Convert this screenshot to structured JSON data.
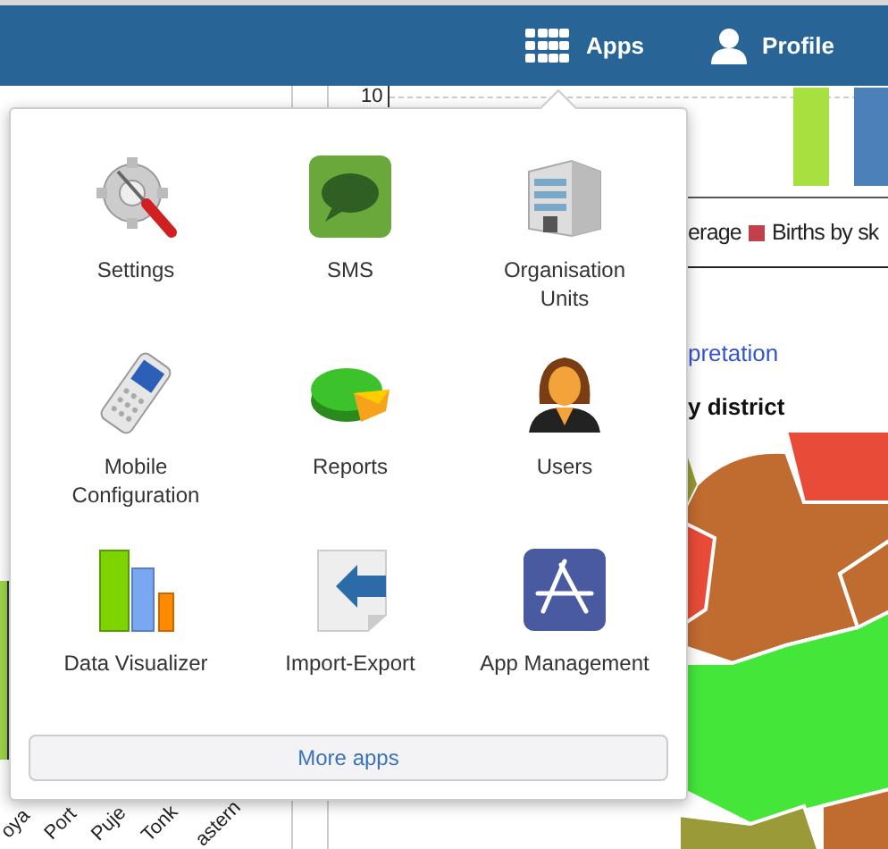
{
  "header": {
    "apps_label": "Apps",
    "profile_label": "Profile"
  },
  "apps_menu": {
    "items": [
      {
        "label": "Settings"
      },
      {
        "label": "SMS"
      },
      {
        "label": "Organisation Units"
      },
      {
        "label": "Mobile Configuration"
      },
      {
        "label": "Reports"
      },
      {
        "label": "Users"
      },
      {
        "label": "Data Visualizer"
      },
      {
        "label": "Import-Export"
      },
      {
        "label": "App Management"
      }
    ],
    "more_button": "More apps"
  },
  "dashboard": {
    "left_panel": {
      "axis_labels": [
        "oya",
        "Port",
        "Puje",
        "Tonk",
        "astern"
      ]
    },
    "chart": {
      "tick": "10",
      "legend": [
        {
          "label": "erage"
        },
        {
          "label": "Births by sk",
          "color": "#c0404c"
        }
      ]
    },
    "interpretation_link": "pretation",
    "map_title": "y district"
  }
}
